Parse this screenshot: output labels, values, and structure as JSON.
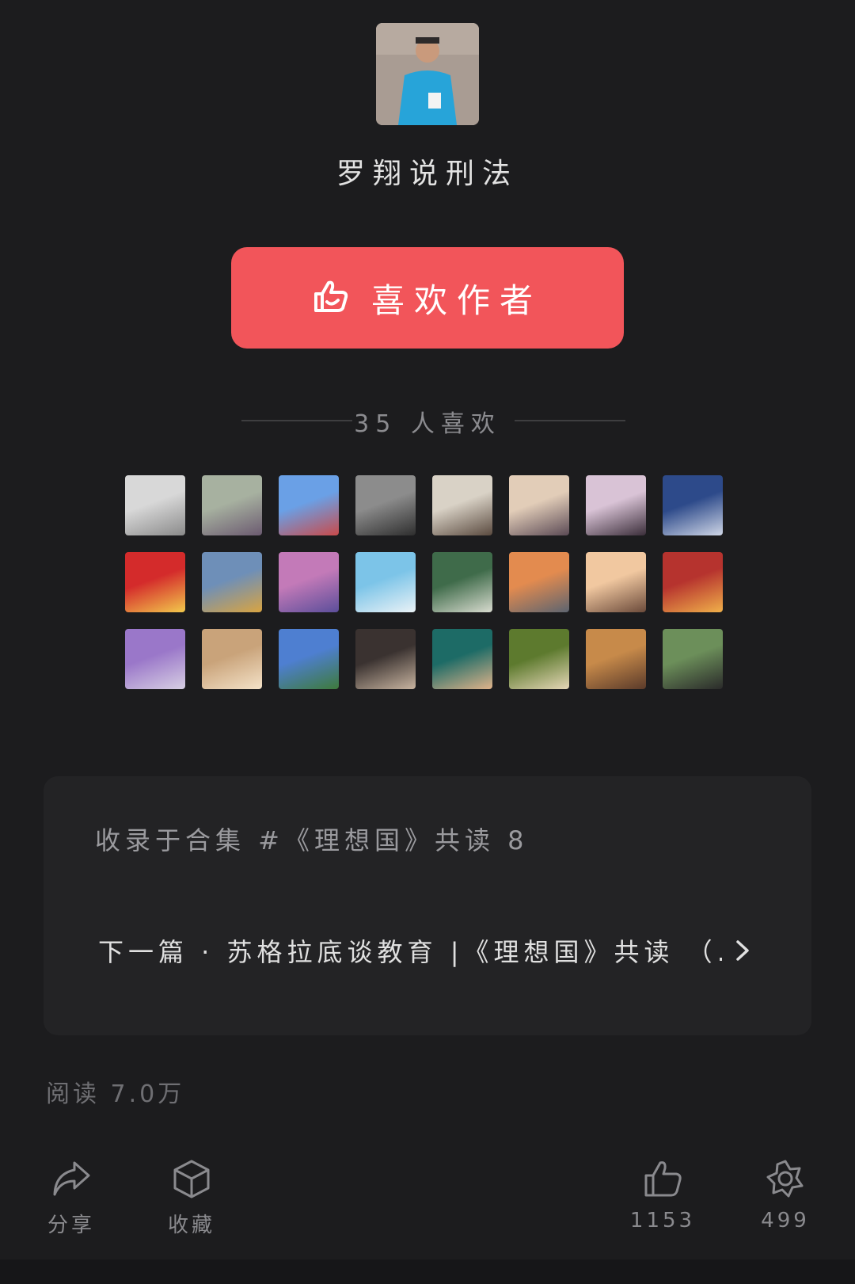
{
  "author": {
    "name": "罗翔说刑法"
  },
  "like_button": {
    "label": "喜欢作者",
    "icon": "thumbs-up-icon"
  },
  "likers": {
    "count_text": "35 人喜欢",
    "avatars": [
      {
        "colors": [
          "#d8d8d8",
          "#8a8a8a"
        ]
      },
      {
        "colors": [
          "#a7b1a0",
          "#6b5a70"
        ]
      },
      {
        "colors": [
          "#6aa0e6",
          "#c94a4a"
        ]
      },
      {
        "colors": [
          "#8c8c8c",
          "#2e2e2e"
        ]
      },
      {
        "colors": [
          "#d9d2c6",
          "#5a4a3f"
        ]
      },
      {
        "colors": [
          "#e2cdb8",
          "#5b4a55"
        ]
      },
      {
        "colors": [
          "#d9c3d6",
          "#3b2e3a"
        ]
      },
      {
        "colors": [
          "#2d4a8a",
          "#cfd6e6"
        ]
      },
      {
        "colors": [
          "#d42b2b",
          "#f2c94c"
        ]
      },
      {
        "colors": [
          "#6e8fb8",
          "#d9a441"
        ]
      },
      {
        "colors": [
          "#c37ab8",
          "#5b4e9a"
        ]
      },
      {
        "colors": [
          "#7cc4e8",
          "#eaf2f6"
        ]
      },
      {
        "colors": [
          "#3f6b4a",
          "#d8dbcf"
        ]
      },
      {
        "colors": [
          "#e38b4f",
          "#5c6470"
        ]
      },
      {
        "colors": [
          "#f1c8a0",
          "#6b4a3a"
        ]
      },
      {
        "colors": [
          "#b6332e",
          "#f0b04a"
        ]
      },
      {
        "colors": [
          "#9a77c9",
          "#d7cfe3"
        ]
      },
      {
        "colors": [
          "#c9a37a",
          "#f4e2c8"
        ]
      },
      {
        "colors": [
          "#4e7fd1",
          "#3e7a3b"
        ]
      },
      {
        "colors": [
          "#3a3230",
          "#c8b4a0"
        ]
      },
      {
        "colors": [
          "#1d6b66",
          "#e0b38a"
        ]
      },
      {
        "colors": [
          "#5d7a2e",
          "#e6d7b8"
        ]
      },
      {
        "colors": [
          "#c78a4a",
          "#5a3a2a"
        ]
      },
      {
        "colors": [
          "#6c8f5a",
          "#2a2a2a"
        ]
      }
    ]
  },
  "collection": {
    "title": "收录于合集 #《理想国》共读 8",
    "next_article": "下一篇 · 苏格拉底谈教育 |《理想国》共读 （..."
  },
  "read_count": "阅读 7.0万",
  "bottom_bar": {
    "share": {
      "label": "分享",
      "icon": "share-icon"
    },
    "favorite": {
      "label": "收藏",
      "icon": "cube-icon"
    },
    "like": {
      "label": "1153",
      "icon": "thumbs-up-icon"
    },
    "wow": {
      "label": "499",
      "icon": "star-icon"
    }
  }
}
